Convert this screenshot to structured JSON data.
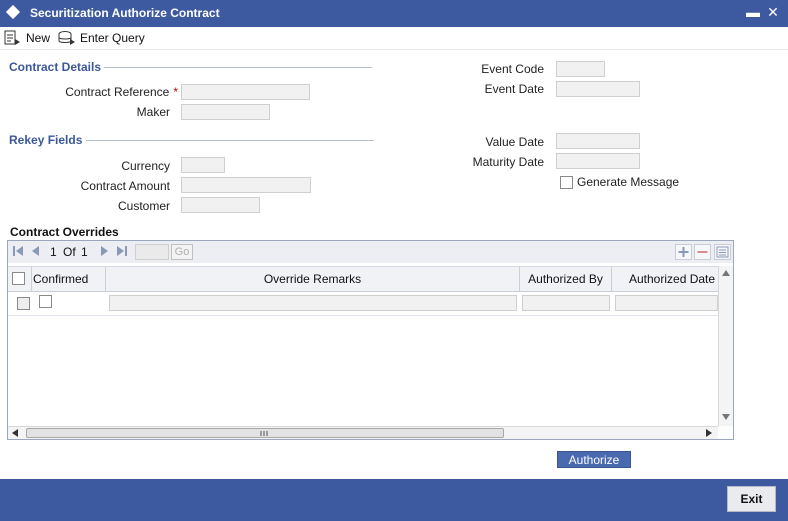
{
  "window": {
    "title": "Securitization Authorize Contract",
    "minimize_label": "▬",
    "close_label": "✕"
  },
  "toolbar": {
    "new_label": "New",
    "enter_query_label": "Enter Query"
  },
  "contract_details": {
    "section_title": "Contract Details",
    "contract_reference_label": "Contract Reference",
    "required_marker": "*",
    "maker_label": "Maker",
    "event_code_label": "Event Code",
    "event_date_label": "Event Date"
  },
  "rekey_fields": {
    "section_title": "Rekey Fields",
    "currency_label": "Currency",
    "contract_amount_label": "Contract Amount",
    "customer_label": "Customer",
    "value_date_label": "Value Date",
    "maturity_date_label": "Maturity Date",
    "generate_message_label": "Generate Message"
  },
  "overrides": {
    "title": "Contract Overrides",
    "pager": {
      "current": "1",
      "of_label": "Of",
      "total": "1",
      "go_label": "Go"
    },
    "columns": [
      "Confirmed",
      "Override Remarks",
      "Authorized By",
      "Authorized Date"
    ]
  },
  "actions": {
    "authorize_label": "Authorize",
    "exit_label": "Exit"
  },
  "colors": {
    "brand_blue": "#3d5aa0",
    "section_title": "#3a5899"
  }
}
